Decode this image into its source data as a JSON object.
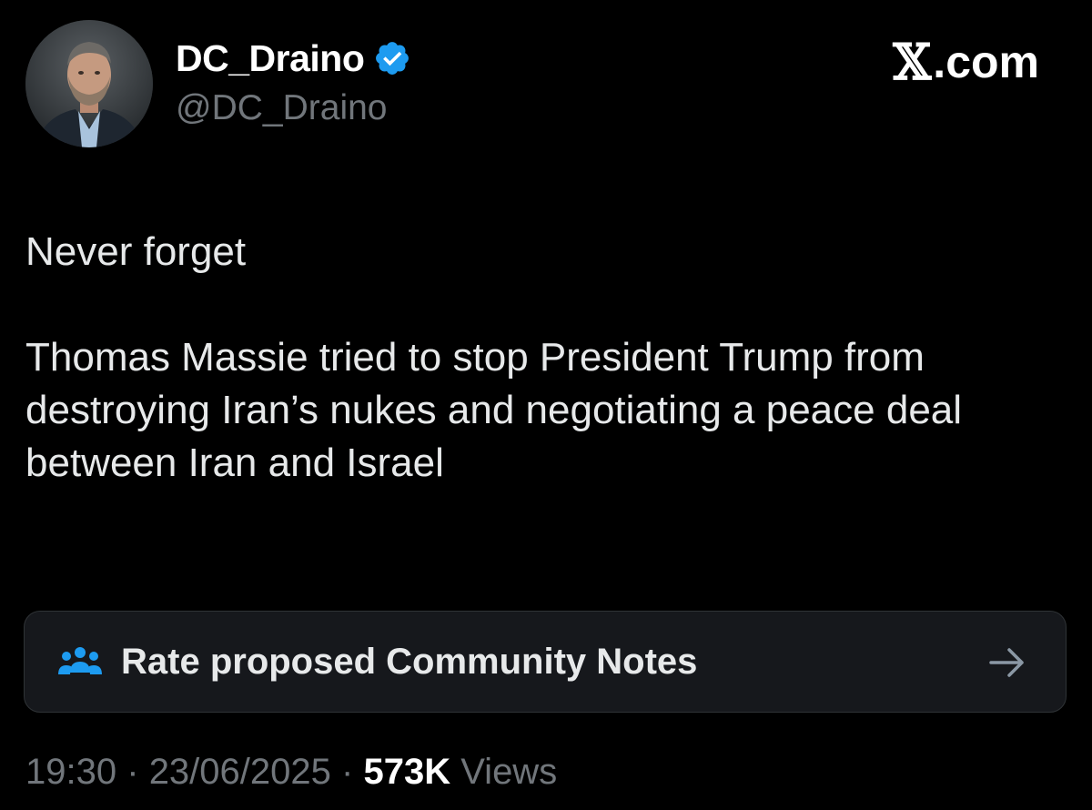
{
  "author": {
    "display_name": "DC_Draino",
    "handle": "@DC_Draino",
    "verified": true,
    "avatar": "profile-photo"
  },
  "brand": {
    "glyph": "𝕏",
    "suffix": ".com"
  },
  "tweet": {
    "line1": "Never forget",
    "paragraph2": "Thomas Massie tried to stop President Trump from destroying Iran’s nukes and negotiating a peace deal between Iran and Israel"
  },
  "community_notes": {
    "label": "Rate proposed Community Notes",
    "icon": "people-icon",
    "arrow_icon": "arrow-right-icon"
  },
  "meta": {
    "time": "19:30",
    "sep1": "·",
    "date": "23/06/2025",
    "sep2": "·",
    "views_count": "573K",
    "views_label": "Views"
  },
  "colors": {
    "background": "#000000",
    "text_primary": "#e7e9ea",
    "text_secondary": "#71767b",
    "verified_blue": "#1d9bf0",
    "card_background": "#16181c"
  }
}
